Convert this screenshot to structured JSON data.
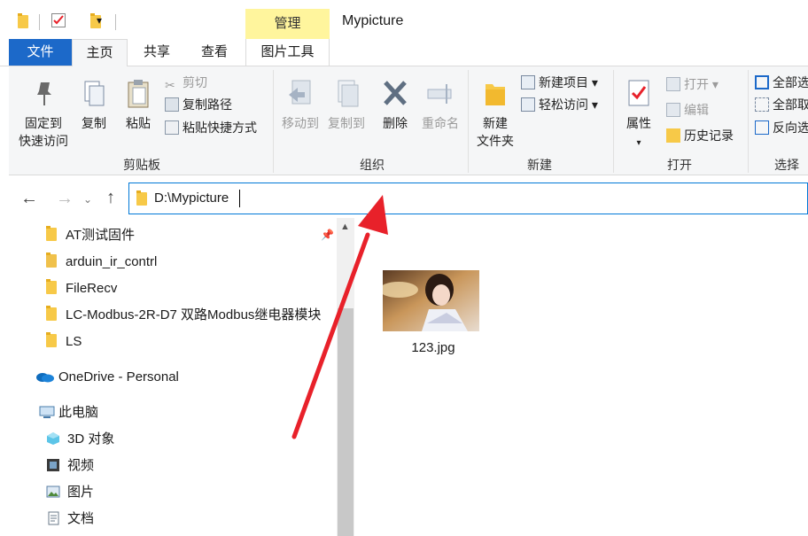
{
  "window": {
    "title": "Mypicture"
  },
  "tabs": {
    "file": "文件",
    "home": "主页",
    "share": "共享",
    "view": "查看",
    "context_header": "管理",
    "picture_tools": "图片工具"
  },
  "ribbon": {
    "clipboard": {
      "label": "剪贴板",
      "pin": [
        "固定到",
        "快速访问"
      ],
      "copy": "复制",
      "paste": "粘贴",
      "cut": "剪切",
      "copy_path": "复制路径",
      "paste_shortcut": "粘贴快捷方式"
    },
    "organize": {
      "label": "组织",
      "move_to": "移动到",
      "copy_to": "复制到",
      "delete": "删除",
      "rename": "重命名"
    },
    "new": {
      "label": "新建",
      "new_folder": [
        "新建",
        "文件夹"
      ],
      "new_item": "新建项目",
      "easy_access": "轻松访问"
    },
    "open": {
      "label": "打开",
      "properties": "属性",
      "open": "打开",
      "edit": "编辑",
      "history": "历史记录"
    },
    "select": {
      "label": "选择",
      "select_all": "全部选",
      "select_none": "全部取",
      "invert": "反向选"
    }
  },
  "address": {
    "path": "D:\\Mypicture"
  },
  "nav": {
    "items": [
      {
        "label": "AT测试固件",
        "icon": "folder-icon"
      },
      {
        "label": "arduin_ir_contrl",
        "icon": "arduino-folder-icon"
      },
      {
        "label": "FileRecv",
        "icon": "folder-icon"
      },
      {
        "label": "LC-Modbus-2R-D7 双路Modbus继电器模块",
        "icon": "folder-icon"
      },
      {
        "label": "LS",
        "icon": "folder-icon"
      },
      {
        "label": "OneDrive - Personal",
        "icon": "onedrive-icon"
      },
      {
        "label": "此电脑",
        "icon": "computer-icon"
      },
      {
        "label": "3D 对象",
        "icon": "3d-objects-icon"
      },
      {
        "label": "视频",
        "icon": "video-icon"
      },
      {
        "label": "图片",
        "icon": "pictures-icon"
      },
      {
        "label": "文档",
        "icon": "documents-icon"
      }
    ]
  },
  "content": {
    "files": [
      {
        "name": "123.jpg",
        "type": "image"
      }
    ]
  },
  "colors": {
    "file_tab": "#1c69c9",
    "context_tab": "#fff59d",
    "address_border": "#0078d7",
    "annotation_arrow": "#e8212a",
    "folder": "#f7c948"
  }
}
